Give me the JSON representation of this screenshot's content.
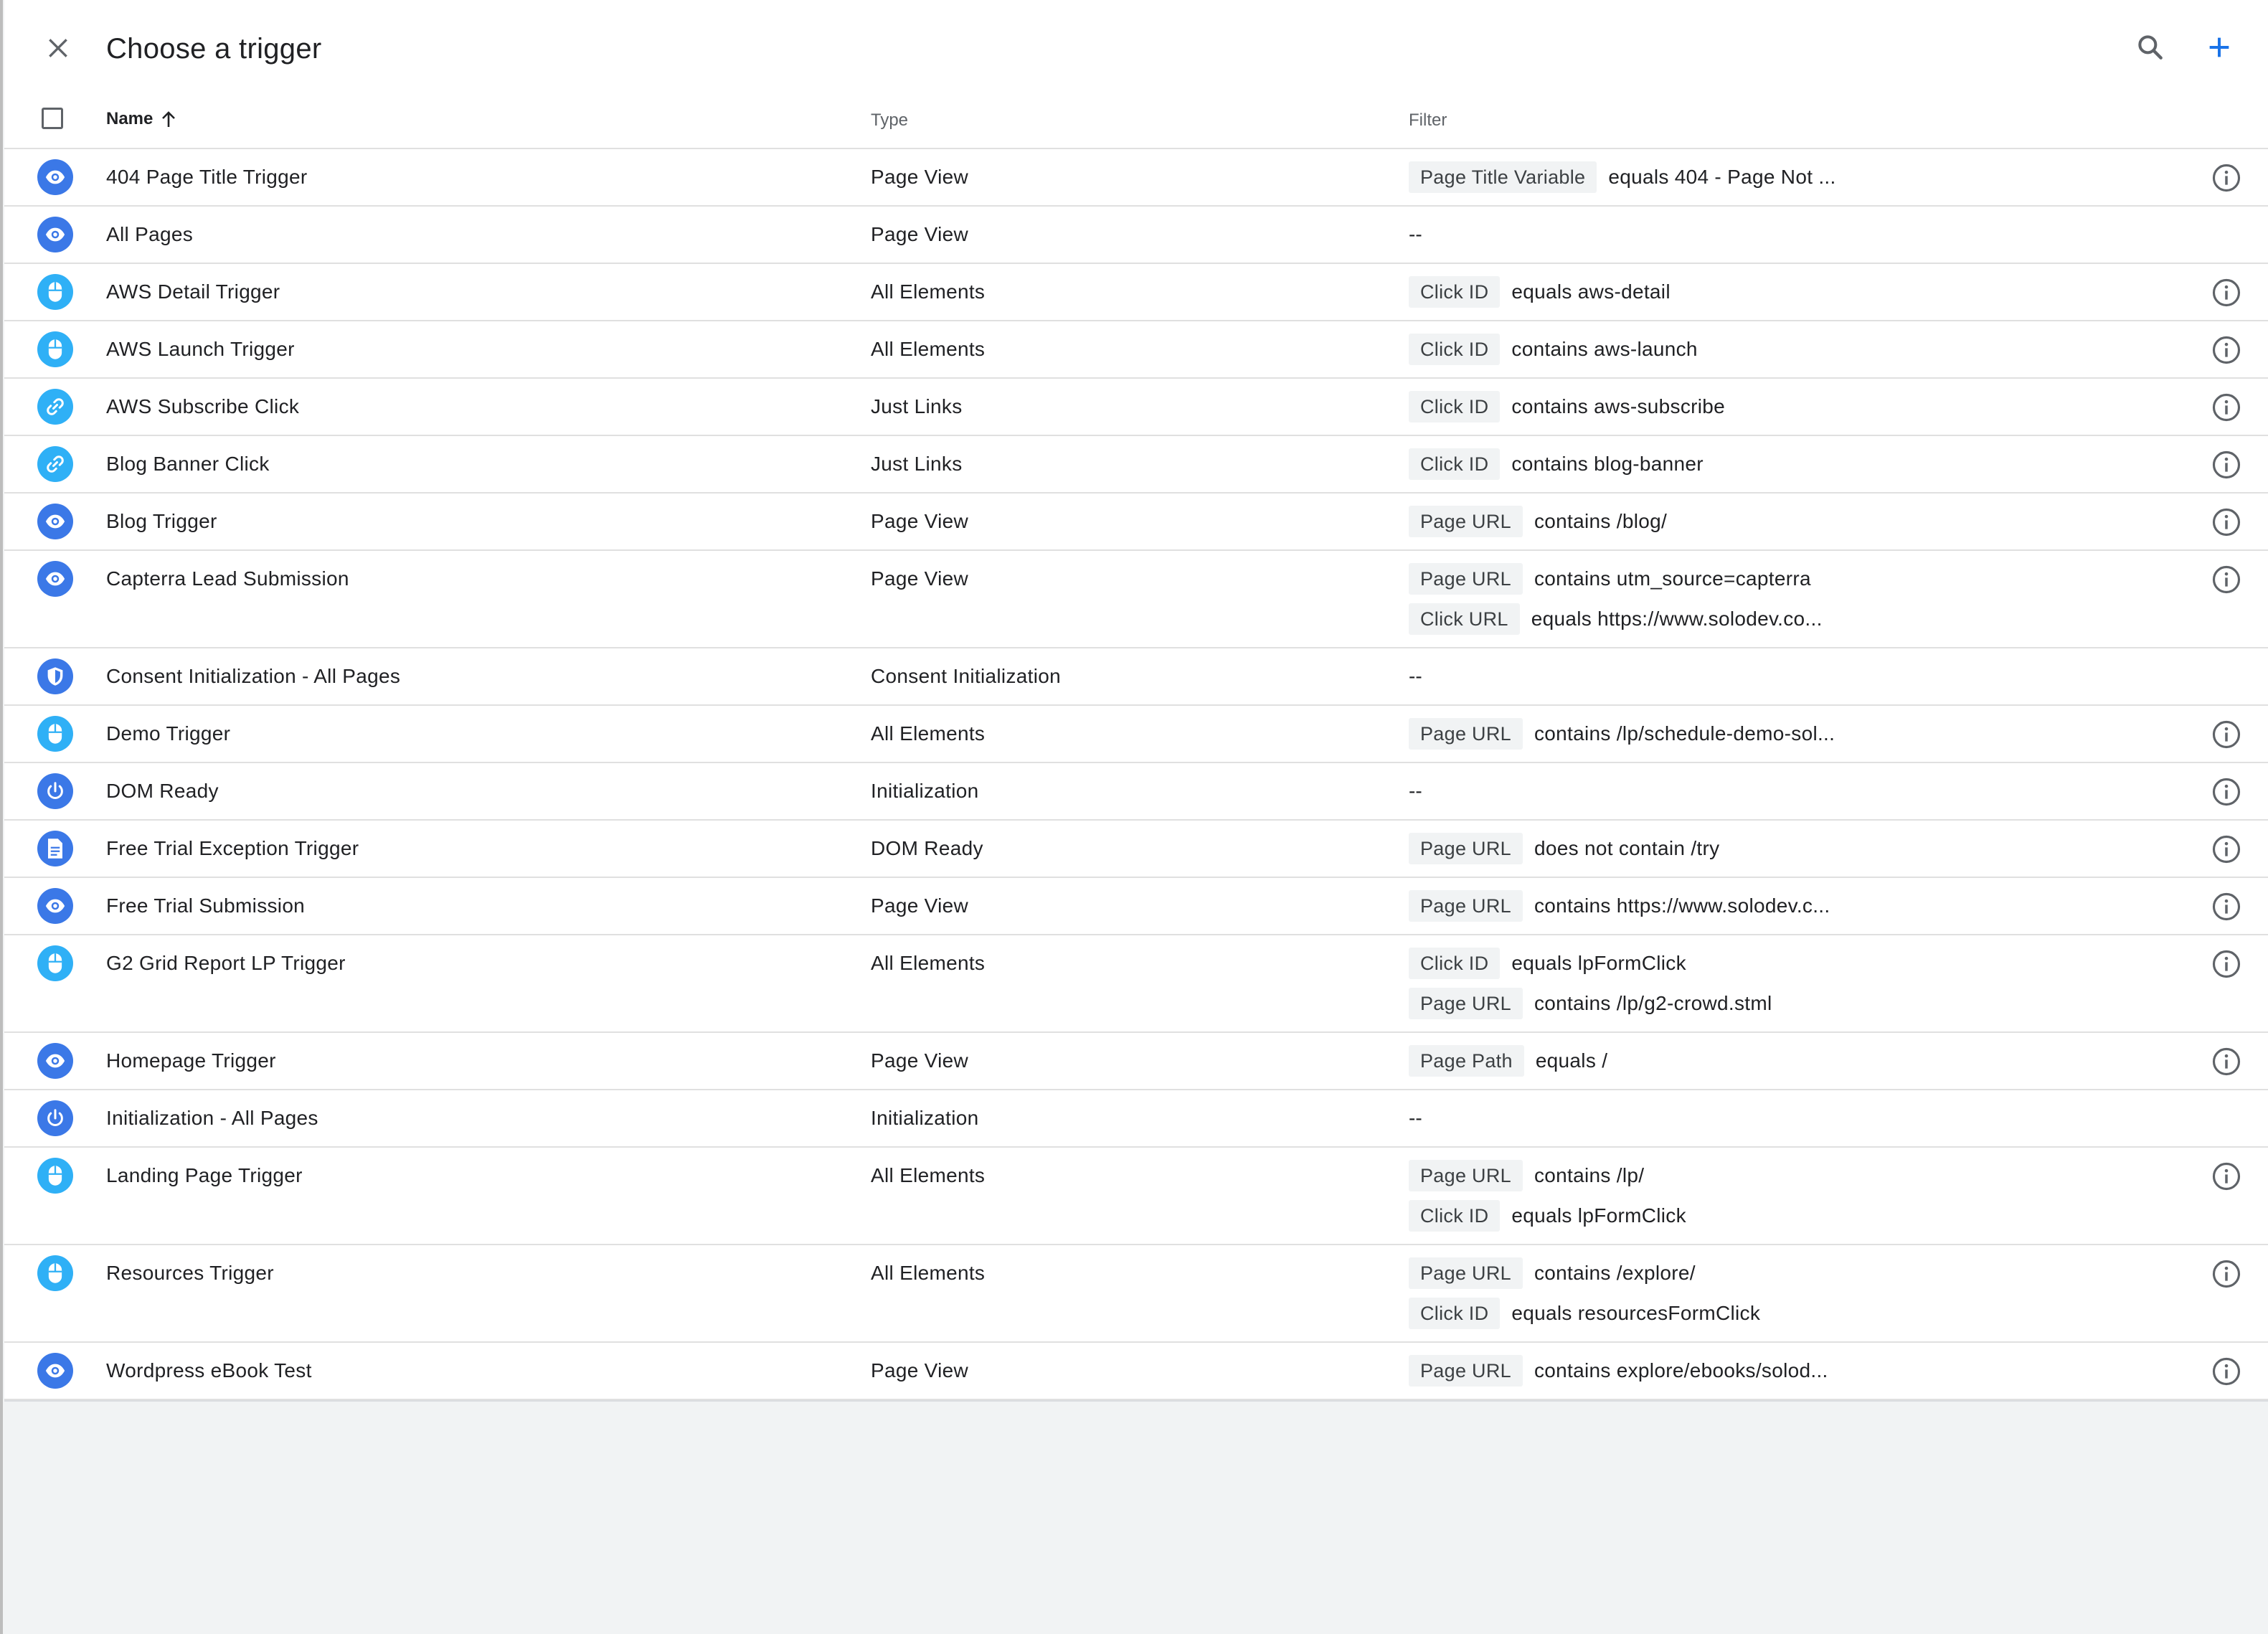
{
  "header": {
    "title": "Choose a trigger"
  },
  "columns": {
    "name": "Name",
    "type": "Type",
    "filter": "Filter"
  },
  "colors": {
    "page_view_icon": "#3b78e7",
    "click_icon": "#2fb0f6",
    "accent_add": "#1a73e8"
  },
  "rows": [
    {
      "name": "404 Page Title Trigger",
      "type": "Page View",
      "icon": "eye-icon",
      "filters": [
        {
          "chip": "Page Title Variable",
          "cond": "equals 404 - Page Not ..."
        }
      ],
      "info": true
    },
    {
      "name": "All Pages",
      "type": "Page View",
      "icon": "eye-icon",
      "filters": [],
      "empty": "--",
      "info": false
    },
    {
      "name": "AWS Detail Trigger",
      "type": "All Elements",
      "icon": "mouse-icon",
      "filters": [
        {
          "chip": "Click ID",
          "cond": "equals aws-detail"
        }
      ],
      "info": true
    },
    {
      "name": "AWS Launch Trigger",
      "type": "All Elements",
      "icon": "mouse-icon",
      "filters": [
        {
          "chip": "Click ID",
          "cond": "contains aws-launch"
        }
      ],
      "info": true
    },
    {
      "name": "AWS Subscribe Click",
      "type": "Just Links",
      "icon": "link-icon",
      "filters": [
        {
          "chip": "Click ID",
          "cond": "contains aws-subscribe"
        }
      ],
      "info": true
    },
    {
      "name": "Blog Banner Click",
      "type": "Just Links",
      "icon": "link-icon",
      "filters": [
        {
          "chip": "Click ID",
          "cond": "contains blog-banner"
        }
      ],
      "info": true
    },
    {
      "name": "Blog Trigger",
      "type": "Page View",
      "icon": "eye-icon",
      "filters": [
        {
          "chip": "Page URL",
          "cond": "contains /blog/"
        }
      ],
      "info": true
    },
    {
      "name": "Capterra Lead Submission",
      "type": "Page View",
      "icon": "eye-icon",
      "filters": [
        {
          "chip": "Page URL",
          "cond": "contains utm_source=capterra"
        },
        {
          "chip": "Click URL",
          "cond": "equals https://www.solodev.co..."
        }
      ],
      "info": true
    },
    {
      "name": "Consent Initialization - All Pages",
      "type": "Consent Initialization",
      "icon": "shield-icon",
      "filters": [],
      "empty": "--",
      "info": false
    },
    {
      "name": "Demo Trigger",
      "type": "All Elements",
      "icon": "mouse-icon",
      "filters": [
        {
          "chip": "Page URL",
          "cond": "contains /lp/schedule-demo-sol..."
        }
      ],
      "info": true
    },
    {
      "name": "DOM Ready",
      "type": "Initialization",
      "icon": "power-icon",
      "filters": [],
      "empty": "--",
      "info": true
    },
    {
      "name": "Free Trial Exception Trigger",
      "type": "DOM Ready",
      "icon": "document-icon",
      "filters": [
        {
          "chip": "Page URL",
          "cond": "does not contain /try"
        }
      ],
      "info": true
    },
    {
      "name": "Free Trial Submission",
      "type": "Page View",
      "icon": "eye-icon",
      "filters": [
        {
          "chip": "Page URL",
          "cond": "contains https://www.solodev.c..."
        }
      ],
      "info": true
    },
    {
      "name": "G2 Grid Report LP Trigger",
      "type": "All Elements",
      "icon": "mouse-icon",
      "filters": [
        {
          "chip": "Click ID",
          "cond": "equals lpFormClick"
        },
        {
          "chip": "Page URL",
          "cond": "contains /lp/g2-crowd.stml"
        }
      ],
      "info": true
    },
    {
      "name": "Homepage Trigger",
      "type": "Page View",
      "icon": "eye-icon",
      "filters": [
        {
          "chip": "Page Path",
          "cond": "equals /"
        }
      ],
      "info": true
    },
    {
      "name": "Initialization - All Pages",
      "type": "Initialization",
      "icon": "power-icon",
      "filters": [],
      "empty": "--",
      "info": false
    },
    {
      "name": "Landing Page Trigger",
      "type": "All Elements",
      "icon": "mouse-icon",
      "filters": [
        {
          "chip": "Page URL",
          "cond": "contains /lp/"
        },
        {
          "chip": "Click ID",
          "cond": "equals lpFormClick"
        }
      ],
      "info": true
    },
    {
      "name": "Resources Trigger",
      "type": "All Elements",
      "icon": "mouse-icon",
      "filters": [
        {
          "chip": "Page URL",
          "cond": "contains /explore/"
        },
        {
          "chip": "Click ID",
          "cond": "equals resourcesFormClick"
        }
      ],
      "info": true
    },
    {
      "name": "Wordpress eBook Test",
      "type": "Page View",
      "icon": "eye-icon",
      "filters": [
        {
          "chip": "Page URL",
          "cond": "contains explore/ebooks/solod..."
        }
      ],
      "info": true
    }
  ]
}
